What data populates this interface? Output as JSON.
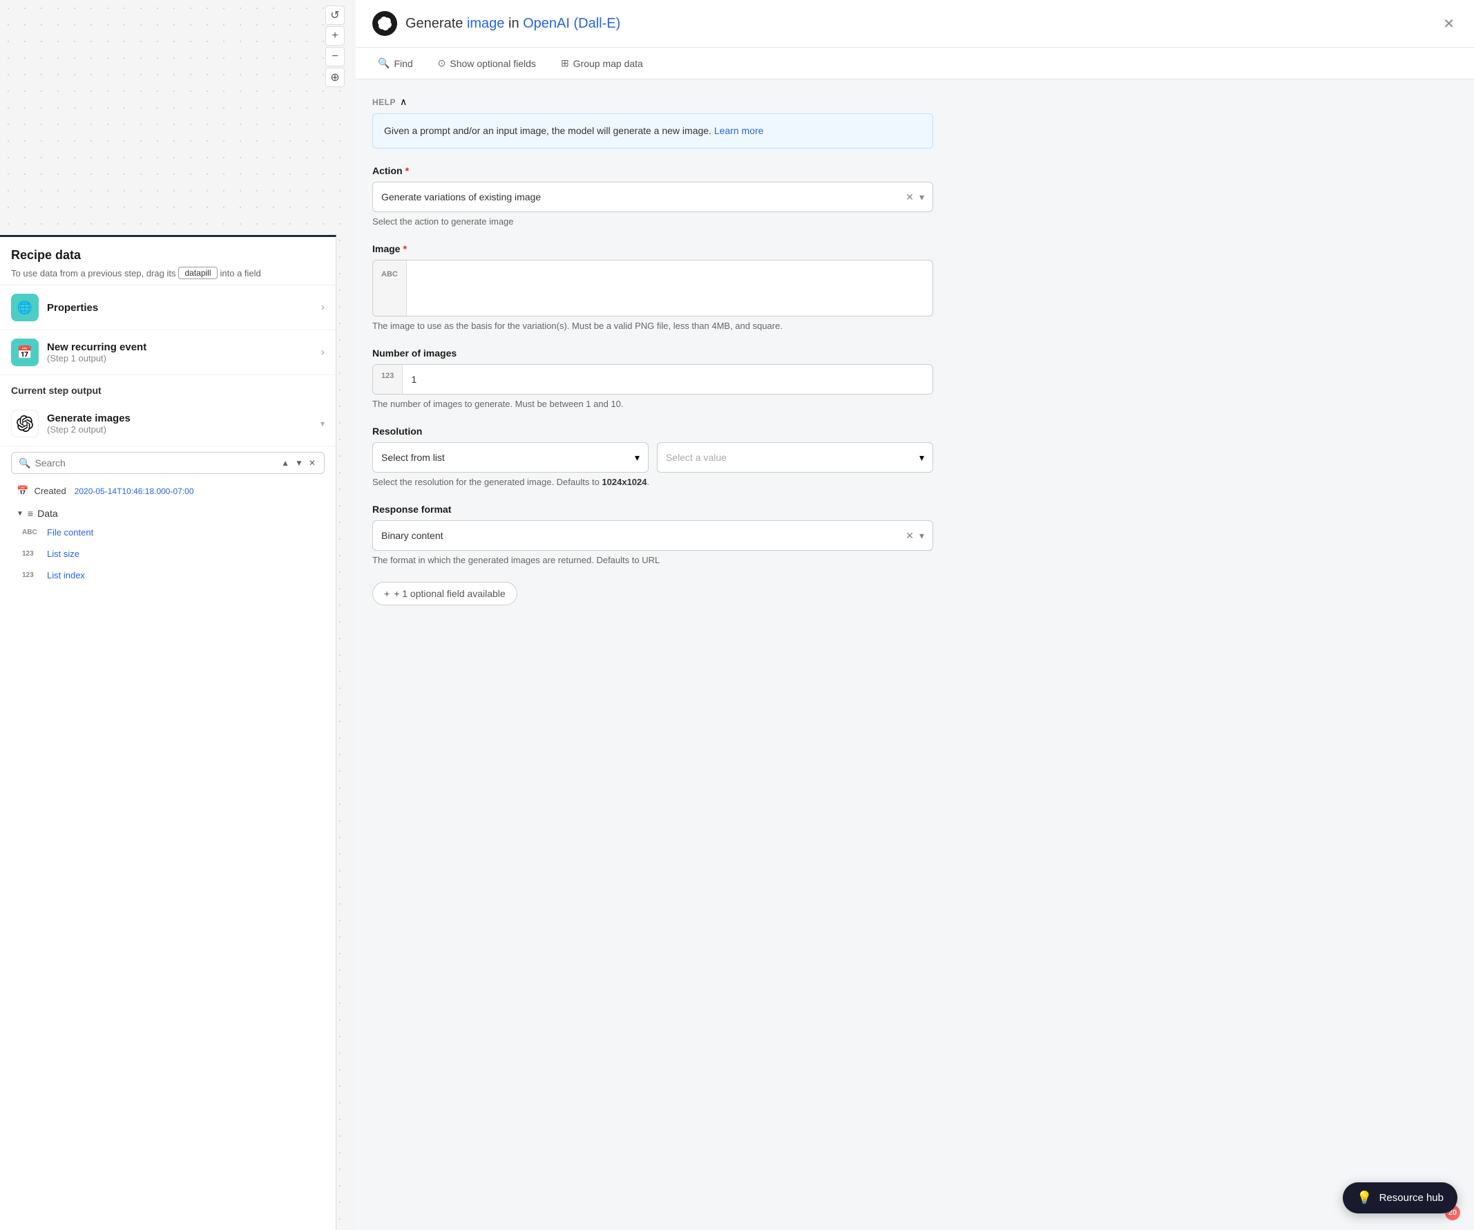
{
  "canvas": {
    "controls": {
      "refresh_label": "↺",
      "zoom_in_label": "+",
      "zoom_out_label": "−",
      "move_label": "⊕"
    }
  },
  "recipe_panel": {
    "title": "Recipe data",
    "description_prefix": "To use data from a previous step, drag its",
    "datapill_label": "datapill",
    "description_suffix": "into a field",
    "sections": [
      {
        "name": "Properties",
        "icon": "🌐",
        "icon_class": "icon-teal"
      },
      {
        "name": "New recurring event",
        "sub": "(Step 1 output)",
        "icon": "📅",
        "icon_class": "icon-teal"
      }
    ],
    "current_step_label": "Current step output",
    "current_step_item": {
      "name": "Generate images",
      "sub": "(Step 2 output)",
      "icon_class": "icon-openai"
    },
    "search_placeholder": "Search",
    "created_label": "Created",
    "created_value": "2020-05-14T10:46:18.000-07:00",
    "data_section_label": "Data",
    "data_fields": [
      {
        "type": "ABC",
        "name": "File content"
      },
      {
        "type": "123",
        "name": "List size"
      },
      {
        "type": "123",
        "name": "List index"
      }
    ]
  },
  "action_panel": {
    "title_prefix": "Generate ",
    "title_highlight": "image",
    "title_middle": " in ",
    "title_service": "OpenAI (Dall-E)",
    "toolbar": {
      "find_label": "Find",
      "show_optional_label": "Show optional fields",
      "group_map_label": "Group map data"
    },
    "help": {
      "section_label": "HELP",
      "text": "Given a prompt and/or an input image, the model will generate a new image.",
      "learn_more": "Learn more"
    },
    "fields": {
      "action": {
        "label": "Action",
        "required": true,
        "value": "Generate variations of existing image",
        "hint": "Select the action to generate image"
      },
      "image": {
        "label": "Image",
        "required": true,
        "prefix": "ABC",
        "hint": "The image to use as the basis for the variation(s). Must be a valid PNG file, less than 4MB, and square."
      },
      "number_of_images": {
        "label": "Number of images",
        "prefix": "123",
        "value": "1",
        "hint": "The number of images to generate. Must be between 1 and 10."
      },
      "resolution": {
        "label": "Resolution",
        "select_list_label": "Select from list",
        "select_value_placeholder": "Select a value",
        "hint_prefix": "Select the resolution for the generated image. Defaults to ",
        "hint_bold": "1024x1024",
        "hint_suffix": "."
      },
      "response_format": {
        "label": "Response format",
        "value": "Binary content",
        "hint_prefix": "The format in which the generated images are returned. Defaults to URL"
      }
    },
    "optional_button": "+ 1 optional field available",
    "resource_hub": {
      "label": "Resource hub",
      "badge": "20"
    }
  }
}
